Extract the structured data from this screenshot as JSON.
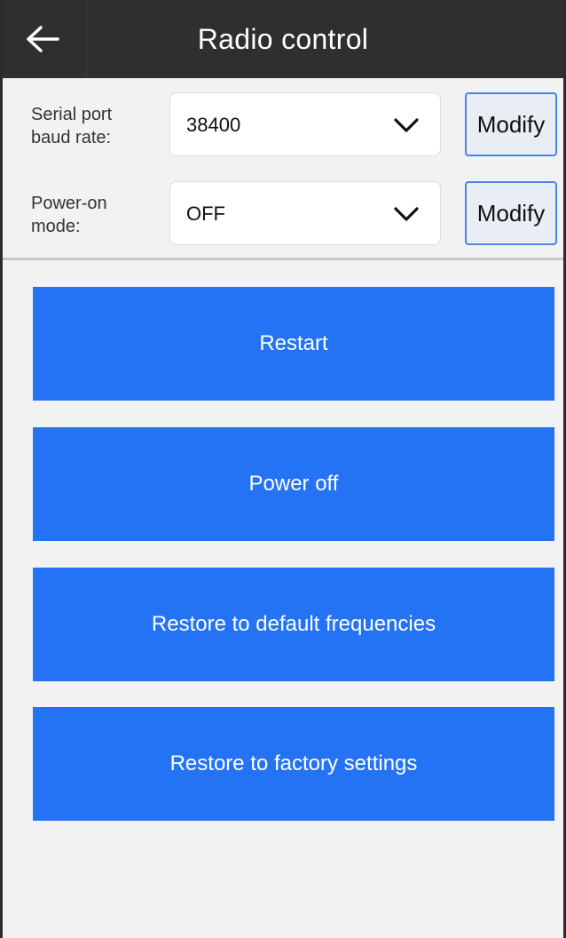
{
  "header": {
    "title": "Radio control",
    "back_icon": "arrow-left-icon"
  },
  "settings": {
    "baud_rate": {
      "label": "Serial port\nbaud rate:",
      "value": "38400",
      "modify_label": "Modify"
    },
    "power_on_mode": {
      "label": "Power-on\nmode:",
      "value": "OFF",
      "modify_label": "Modify"
    }
  },
  "actions": {
    "restart": "Restart",
    "power_off": "Power off",
    "restore_frequencies": "Restore to default frequencies",
    "restore_factory": "Restore to factory settings"
  },
  "colors": {
    "header_bg": "#2f2f2f",
    "action_blue": "#2473f5",
    "modify_border": "#4c85e8",
    "page_bg": "#f2f2f2"
  }
}
